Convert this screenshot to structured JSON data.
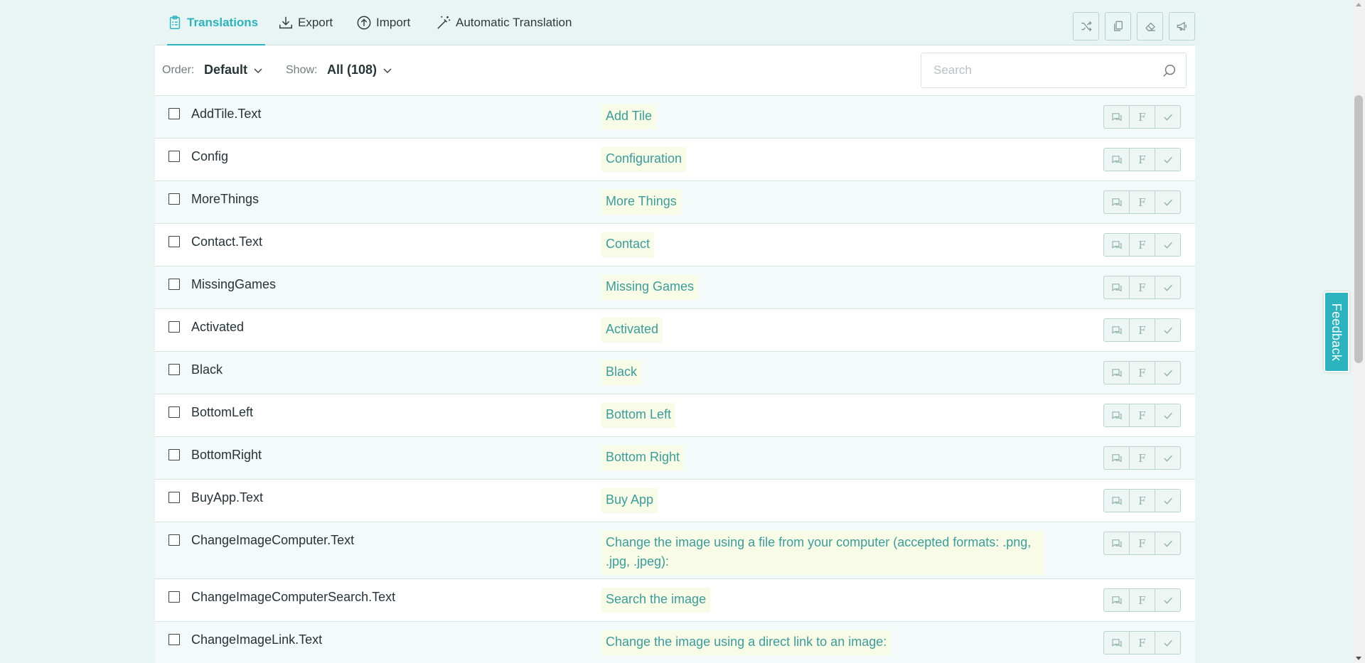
{
  "tabs": [
    {
      "label": "Translations",
      "icon": "clipboard-icon",
      "active": true
    },
    {
      "label": "Export",
      "icon": "download-icon"
    },
    {
      "label": "Import",
      "icon": "upload-circle-icon"
    },
    {
      "label": "Automatic Translation",
      "icon": "magic-wand-icon"
    }
  ],
  "toolbar": {
    "icons": [
      "shuffle-icon",
      "copy-icon",
      "eraser-icon",
      "megaphone-icon"
    ]
  },
  "filter": {
    "order_label": "Order:",
    "order_value": "Default",
    "show_label": "Show:",
    "show_value": "All (108)",
    "search_placeholder": "Search"
  },
  "rows": [
    {
      "key": "AddTile.Text",
      "value": "Add Tile"
    },
    {
      "key": "Config",
      "value": "Configuration"
    },
    {
      "key": "MoreThings",
      "value": "More Things"
    },
    {
      "key": "Contact.Text",
      "value": "Contact"
    },
    {
      "key": "MissingGames",
      "value": "Missing Games"
    },
    {
      "key": "Activated",
      "value": "Activated"
    },
    {
      "key": "Black",
      "value": "Black"
    },
    {
      "key": "BottomLeft",
      "value": "Bottom Left"
    },
    {
      "key": "BottomRight",
      "value": "Bottom Right"
    },
    {
      "key": "BuyApp.Text",
      "value": "Buy App"
    },
    {
      "key": "ChangeImageComputer.Text",
      "value": "Change the image using a file from your computer (accepted formats: .png, .jpg, .jpeg):"
    },
    {
      "key": "ChangeImageComputerSearch.Text",
      "value": "Search the image"
    },
    {
      "key": "ChangeImageLink.Text",
      "value": "Change the image using a direct link to an image:"
    }
  ],
  "row_actions": {
    "comment_icon": "comment-icon",
    "f_label": "F",
    "check_icon": "check-icon"
  },
  "feedback_label": "Feedback",
  "colors": {
    "accent": "#2bb4bf",
    "background": "#e9f5f3",
    "value_text": "#3a9d9d",
    "value_bg": "#f8fbe5"
  }
}
